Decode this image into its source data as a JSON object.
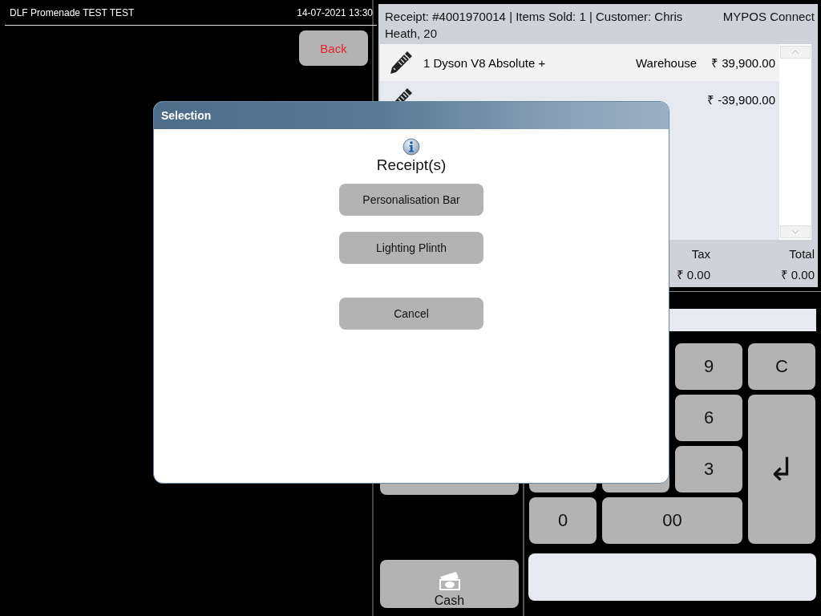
{
  "store": {
    "name": "DLF Promenade TEST TEST",
    "datetime": "14-07-2021 13:30"
  },
  "back_button": "Back",
  "receipt": {
    "summary": "Receipt: #4001970014 | Items Sold: 1 | Customer: Chris Heath, 20",
    "app_name": "MYPOS Connect",
    "lines": [
      {
        "kind": "item",
        "description": "1 Dyson V8 Absolute +",
        "location": "Warehouse",
        "amount": "₹ 39,900.00"
      },
      {
        "kind": "payment",
        "amount": "₹ -39,900.00"
      }
    ],
    "totals": [
      {
        "label": "Tax",
        "value": "₹ 0.00"
      },
      {
        "label": "Total",
        "value": "₹ 0.00"
      }
    ]
  },
  "keypad": [
    {
      "label": "9",
      "kind": "digit"
    },
    {
      "label": "C",
      "kind": "clear"
    },
    {
      "label": "6",
      "kind": "digit"
    },
    {
      "label": "↲",
      "kind": "enter"
    },
    {
      "label": "3",
      "kind": "digit"
    },
    {
      "label": "0",
      "kind": "digit"
    },
    {
      "label": "00",
      "kind": "wide"
    }
  ],
  "tender_buttons": [
    {
      "label": "Cash",
      "kind": "cash"
    }
  ],
  "dialog": {
    "title": "Selection",
    "heading": "Receipt(s)",
    "options": [
      "Personalisation Bar",
      "Lighting Plinth"
    ],
    "cancel": "Cancel"
  }
}
